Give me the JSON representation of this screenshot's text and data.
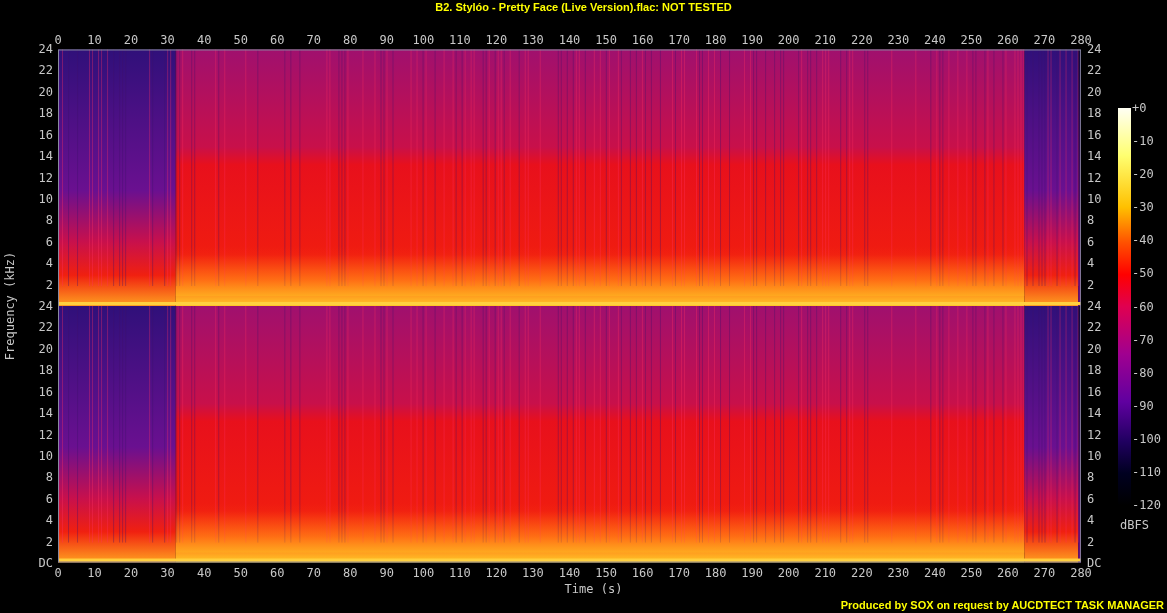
{
  "title": "B2. Stylóo - Pretty Face (Live Version).flac: NOT TESTED",
  "x_axis": {
    "label": "Time (s)",
    "top_ticks": [
      "0",
      "10",
      "20",
      "30",
      "40",
      "50",
      "60",
      "70",
      "80",
      "90",
      "100",
      "110",
      "120",
      "130",
      "140",
      "150",
      "160",
      "170",
      "180",
      "190",
      "200",
      "210",
      "220",
      "230",
      "240",
      "250",
      "260",
      "270",
      "280"
    ],
    "bottom_ticks": [
      "0",
      "10",
      "20",
      "30",
      "40",
      "50",
      "60",
      "70",
      "80",
      "90",
      "100",
      "110",
      "120",
      "130",
      "140",
      "150",
      "160",
      "170",
      "180",
      "190",
      "200",
      "210",
      "220",
      "230",
      "240",
      "250",
      "260",
      "270",
      "280"
    ]
  },
  "y_axis": {
    "label": "Frequency (kHz)",
    "left_upper_ticks": [
      "24",
      "22",
      "20",
      "18",
      "16",
      "14",
      "12",
      "10",
      "8",
      "6",
      "4",
      "2"
    ],
    "left_lower_ticks": [
      "24",
      "22",
      "20",
      "18",
      "16",
      "14",
      "12",
      "10",
      "8",
      "6",
      "4",
      "2",
      "DC"
    ],
    "right_upper_ticks": [
      "24",
      "22",
      "20",
      "18",
      "16",
      "14",
      "12",
      "10",
      "8",
      "6",
      "4",
      "2"
    ],
    "right_lower_ticks": [
      "24",
      "22",
      "20",
      "18",
      "16",
      "14",
      "12",
      "10",
      "8",
      "6",
      "4",
      "2",
      "DC"
    ]
  },
  "colorbar": {
    "ticks": [
      "+0",
      "-10",
      "-20",
      "-30",
      "-40",
      "-50",
      "-60",
      "-70",
      "-80",
      "-90",
      "-100",
      "-110",
      "-120"
    ],
    "unit": "dBFS"
  },
  "footer": "Produced by SOX on request by AUCDTECT TASK MANAGER"
}
